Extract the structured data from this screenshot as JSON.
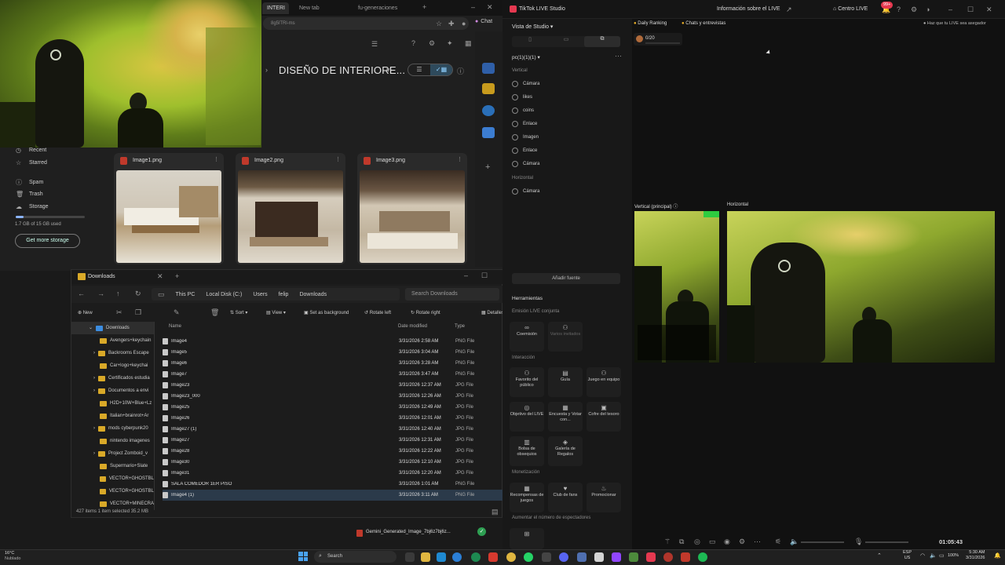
{
  "chrome": {
    "tabs": [
      {
        "label": "INTERI",
        "active": true
      },
      {
        "label": "New tab",
        "active": false
      },
      {
        "label": "fu-generaciones",
        "active": false
      }
    ],
    "address": "8g5lTRl-ms",
    "chat_label": "Chat",
    "folder_title": "DISEÑO DE INTERIORE...",
    "sidebar": [
      {
        "icon": "clock-icon",
        "label": "Recent"
      },
      {
        "icon": "star-icon",
        "label": "Starred"
      },
      {
        "icon": "spam-icon",
        "label": "Spam"
      },
      {
        "icon": "trash-icon",
        "label": "Trash"
      },
      {
        "icon": "cloud-icon",
        "label": "Storage"
      }
    ],
    "storage_text": "1.7 GB of 15 GB used",
    "storage_fraction": 0.11,
    "get_storage": "Get more storage",
    "files": [
      {
        "name": "Image1.png"
      },
      {
        "name": "Image2.png"
      },
      {
        "name": "Image3.png"
      }
    ]
  },
  "explorer": {
    "title": "Downloads",
    "breadcrumb": [
      "This PC",
      "Local Disk (C:)",
      "Users",
      "felip",
      "Downloads"
    ],
    "search_placeholder": "Search Downloads",
    "toolbar": [
      "New",
      "Sort",
      "View",
      "Set as background",
      "Rotate left",
      "Rotate right",
      "Detalles"
    ],
    "nav": [
      {
        "label": "Downloads",
        "selected": true
      },
      {
        "label": "Avengers+keychain",
        "selected": false
      },
      {
        "label": "Backrooms Escape",
        "selected": false
      },
      {
        "label": "Car+logo+keychai",
        "selected": false
      },
      {
        "label": "Certificados estudia",
        "selected": false
      },
      {
        "label": "Documentos a envi",
        "selected": false
      },
      {
        "label": "H2D+10W+Blue+Lz",
        "selected": false
      },
      {
        "label": "Italian+brainrot+Ar",
        "selected": false
      },
      {
        "label": "mods cyberpunk20",
        "selected": false
      },
      {
        "label": "nintendo imagenes",
        "selected": false
      },
      {
        "label": "Project Zomboid_v",
        "selected": false
      },
      {
        "label": "Supermario+Slate",
        "selected": false
      },
      {
        "label": "VECTOR+GHOSTBL",
        "selected": false
      },
      {
        "label": "VECTOR+GHOSTBL",
        "selected": false
      },
      {
        "label": "VECTOR+MINECRA",
        "selected": false
      }
    ],
    "columns": [
      "Name",
      "Date modified",
      "Type"
    ],
    "rows": [
      {
        "name": "Image4",
        "date": "3/31/2026 2:58 AM",
        "type": "PNG File",
        "selected": false
      },
      {
        "name": "Image5",
        "date": "3/31/2026 3:04 AM",
        "type": "PNG File",
        "selected": false
      },
      {
        "name": "Image6",
        "date": "3/31/2026 3:28 AM",
        "type": "PNG File",
        "selected": false
      },
      {
        "name": "Image7",
        "date": "3/31/2026 3:47 AM",
        "type": "PNG File",
        "selected": false
      },
      {
        "name": "Image23",
        "date": "3/31/2026 12:37 AM",
        "type": "JPG File",
        "selected": false
      },
      {
        "name": "Image23_000",
        "date": "3/31/2026 12:26 AM",
        "type": "JPG File",
        "selected": false
      },
      {
        "name": "Image25",
        "date": "3/31/2026 12:49 AM",
        "type": "JPG File",
        "selected": false
      },
      {
        "name": "Image26",
        "date": "3/31/2026 12:01 AM",
        "type": "JPG File",
        "selected": false
      },
      {
        "name": "Image27 (1)",
        "date": "3/31/2026 12:40 AM",
        "type": "JPG File",
        "selected": false
      },
      {
        "name": "Image27",
        "date": "3/31/2026 12:31 AM",
        "type": "JPG File",
        "selected": false
      },
      {
        "name": "Image28",
        "date": "3/31/2026 12:22 AM",
        "type": "JPG File",
        "selected": false
      },
      {
        "name": "Image30",
        "date": "3/31/2026 12:10 AM",
        "type": "JPG File",
        "selected": false
      },
      {
        "name": "Image31",
        "date": "3/31/2026 12:20 AM",
        "type": "JPG File",
        "selected": false
      },
      {
        "name": "SALA COMEDOR 1ER PISO",
        "date": "3/31/2026 1:01 AM",
        "type": "PNG File",
        "selected": false
      },
      {
        "name": "Image4 (1)",
        "date": "3/31/2026 3:11 AM",
        "type": "PNG File",
        "selected": true
      }
    ],
    "status": "427 items   1 item selected  35.2 MB"
  },
  "download": {
    "name": "Gemini_Generated_Image_7bj6z7bj6z..."
  },
  "tiktok": {
    "app_title": "TikTok LIVE Studio",
    "live_info": "Información sobre el LIVE",
    "centro": "Centro LIVE",
    "badge": "99+",
    "studio_view": "Vista de Studio",
    "scene_name": "pc(1)(1)(1)",
    "vertical_label": "Vertical",
    "vertical_sources": [
      "Cámara",
      "likes",
      "coins",
      "Enlace",
      "Imagen",
      "Enlace",
      "Cámara"
    ],
    "horizontal_label": "Horizontal",
    "horizontal_sources": [
      "Cámara"
    ],
    "add_source": "Añadir fuente",
    "tools_label": "Herramientas",
    "joint_label": "Emisión LIVE conjunta",
    "tools_row1": [
      "Coemisión",
      "Varios invitados"
    ],
    "interaction_label": "Interacción",
    "tools_row2": [
      "Favorito del público",
      "Guía",
      "Juego en equipo"
    ],
    "tools_row3": [
      "Objetivo del LIVE",
      "Encuesta y Votar con...",
      "Cofre del tesoro"
    ],
    "tools_row4": [
      "Bolsa de obsequios",
      "Galería de Regalos"
    ],
    "monetization_label": "Monetización",
    "tools_row5": [
      "Recompensas de juegos",
      "Club de fans",
      "Promocionar"
    ],
    "grow_label": "Aumentar el número de espectadores",
    "daily_ranking": "Daily Ranking",
    "chats": "Chats y entrevistas",
    "goal": "0/20",
    "promo": "Haz que tu LIVE sea asegador",
    "preview_vertical": "Vertical (principal)",
    "preview_horizontal": "Horizontal",
    "timer": "01:05:43"
  },
  "taskbar": {
    "weather_temp": "16°C",
    "weather_text": "Nublado",
    "search": "Search",
    "lang": "ESP",
    "region": "US",
    "battery": "100%",
    "time": "5:30 AM",
    "date": "3/31/2026"
  }
}
